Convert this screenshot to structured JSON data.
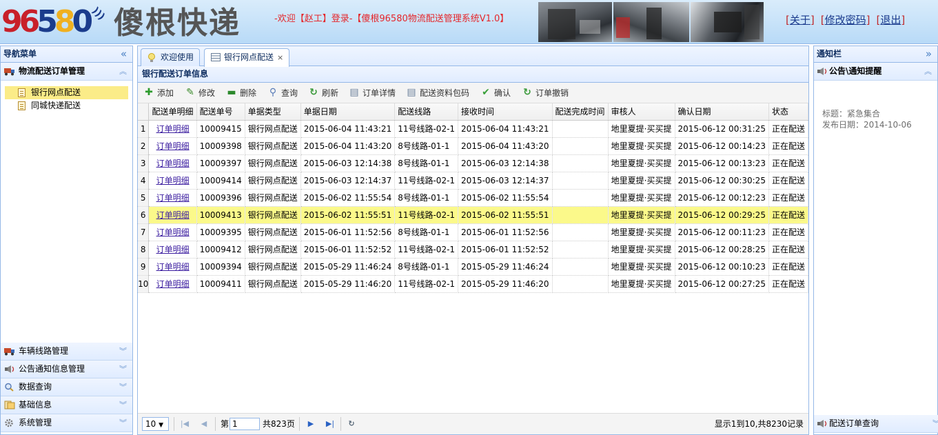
{
  "header": {
    "logo_digits": [
      "9",
      "6",
      "5",
      "8",
      "0"
    ],
    "brand": "傻根快递",
    "welcome": "-欢迎【赵工】登录-【傻根96580物流配送管理系统V1.0】",
    "links": [
      "关于",
      "修改密码",
      "退出"
    ]
  },
  "left": {
    "title": "导航菜单",
    "collapse_icon": "«",
    "active_section": "物流配送订单管理",
    "tree_items": [
      "银行网点配送",
      "同城快递配送"
    ],
    "other_sections": [
      "车辆线路管理",
      "公告通知信息管理",
      "数据查询",
      "基础信息",
      "系统管理"
    ]
  },
  "center": {
    "tabs": [
      {
        "label": "欢迎使用",
        "icon": "bulb-icon"
      },
      {
        "label": "银行网点配送",
        "icon": "grid-icon",
        "close": "×"
      }
    ],
    "grid_title": "银行配送订单信息",
    "toolbar": [
      {
        "label": "添加",
        "icon": "add-icon",
        "glyph": "✚",
        "color": "#2d9b2d"
      },
      {
        "label": "修改",
        "icon": "edit-icon",
        "glyph": "✎",
        "color": "#3a8a2a"
      },
      {
        "label": "删除",
        "icon": "delete-icon",
        "glyph": "▬",
        "color": "#2d8a2d"
      },
      {
        "label": "查询",
        "icon": "search-icon",
        "glyph": "⚲",
        "color": "#5a7db8"
      },
      {
        "label": "刷新",
        "icon": "refresh-icon",
        "glyph": "↻",
        "color": "#3a9a3a"
      },
      {
        "label": "订单详情",
        "icon": "detail-icon",
        "glyph": "▤",
        "color": "#6a7f9a"
      },
      {
        "label": "配送资料包码",
        "icon": "package-icon",
        "glyph": "▤",
        "color": "#6a7f9a"
      },
      {
        "label": "确认",
        "icon": "check-icon",
        "glyph": "✔",
        "color": "#3aa03a"
      },
      {
        "label": "订单撤销",
        "icon": "undo-icon",
        "glyph": "↻",
        "color": "#3a9a3a"
      }
    ],
    "columns": [
      "配送单明细",
      "配送单号",
      "单据类型",
      "单据日期",
      "配送线路",
      "接收时间",
      "配送完成时间",
      "审核人",
      "确认日期",
      "状态"
    ],
    "rows": [
      {
        "n": "1",
        "link": "订单明细",
        "no": "10009415",
        "type": "银行网点配送",
        "date": "2015-06-04 11:43:21",
        "route": "11号线路-02-1",
        "recv": "2015-06-04 11:43:21",
        "done": "",
        "auditor": "地里夏提·买买提",
        "confirm": "2015-06-12 00:31:25",
        "status": "正在配送"
      },
      {
        "n": "2",
        "link": "订单明细",
        "no": "10009398",
        "type": "银行网点配送",
        "date": "2015-06-04 11:43:20",
        "route": "8号线路-01-1",
        "recv": "2015-06-04 11:43:20",
        "done": "",
        "auditor": "地里夏提·买买提",
        "confirm": "2015-06-12 00:14:23",
        "status": "正在配送"
      },
      {
        "n": "3",
        "link": "订单明细",
        "no": "10009397",
        "type": "银行网点配送",
        "date": "2015-06-03 12:14:38",
        "route": "8号线路-01-1",
        "recv": "2015-06-03 12:14:38",
        "done": "",
        "auditor": "地里夏提·买买提",
        "confirm": "2015-06-12 00:13:23",
        "status": "正在配送"
      },
      {
        "n": "4",
        "link": "订单明细",
        "no": "10009414",
        "type": "银行网点配送",
        "date": "2015-06-03 12:14:37",
        "route": "11号线路-02-1",
        "recv": "2015-06-03 12:14:37",
        "done": "",
        "auditor": "地里夏提·买买提",
        "confirm": "2015-06-12 00:30:25",
        "status": "正在配送"
      },
      {
        "n": "5",
        "link": "订单明细",
        "no": "10009396",
        "type": "银行网点配送",
        "date": "2015-06-02 11:55:54",
        "route": "8号线路-01-1",
        "recv": "2015-06-02 11:55:54",
        "done": "",
        "auditor": "地里夏提·买买提",
        "confirm": "2015-06-12 00:12:23",
        "status": "正在配送"
      },
      {
        "n": "6",
        "link": "订单明细",
        "no": "10009413",
        "type": "银行网点配送",
        "date": "2015-06-02 11:55:51",
        "route": "11号线路-02-1",
        "recv": "2015-06-02 11:55:51",
        "done": "",
        "auditor": "地里夏提·买买提",
        "confirm": "2015-06-12 00:29:25",
        "status": "正在配送",
        "highlight": true
      },
      {
        "n": "7",
        "link": "订单明细",
        "no": "10009395",
        "type": "银行网点配送",
        "date": "2015-06-01 11:52:56",
        "route": "8号线路-01-1",
        "recv": "2015-06-01 11:52:56",
        "done": "",
        "auditor": "地里夏提·买买提",
        "confirm": "2015-06-12 00:11:23",
        "status": "正在配送"
      },
      {
        "n": "8",
        "link": "订单明细",
        "no": "10009412",
        "type": "银行网点配送",
        "date": "2015-06-01 11:52:52",
        "route": "11号线路-02-1",
        "recv": "2015-06-01 11:52:52",
        "done": "",
        "auditor": "地里夏提·买买提",
        "confirm": "2015-06-12 00:28:25",
        "status": "正在配送"
      },
      {
        "n": "9",
        "link": "订单明细",
        "no": "10009394",
        "type": "银行网点配送",
        "date": "2015-05-29 11:46:24",
        "route": "8号线路-01-1",
        "recv": "2015-05-29 11:46:24",
        "done": "",
        "auditor": "地里夏提·买买提",
        "confirm": "2015-06-12 00:10:23",
        "status": "正在配送"
      },
      {
        "n": "10",
        "link": "订单明细",
        "no": "10009411",
        "type": "银行网点配送",
        "date": "2015-05-29 11:46:20",
        "route": "11号线路-02-1",
        "recv": "2015-05-29 11:46:20",
        "done": "",
        "auditor": "地里夏提·买买提",
        "confirm": "2015-06-12 00:27:25",
        "status": "正在配送"
      }
    ],
    "pager": {
      "page_size": "10",
      "dropdown": "▼",
      "first": "|◀",
      "prev": "◀",
      "page_prefix": "第",
      "page": "1",
      "total_pages": "共823页",
      "next": "▶",
      "last": "▶|",
      "refresh": "↻",
      "info": "显示1到10,共8230记录"
    }
  },
  "right": {
    "title": "通知栏",
    "collapse_icon": "»",
    "section": "公告\\通知提醒",
    "notice_title": "标题：紧急集合",
    "notice_date": "发布日期：2014-10-06",
    "bottom_section": "配送订单查询"
  },
  "colors": {
    "brand_red": "#c8202a",
    "brand_blue": "#1b3c8c",
    "brand_yellow": "#f0b020",
    "panel_border": "#95b8e7",
    "highlight_row": "#fbf98a",
    "link": "#3c1ea0"
  }
}
